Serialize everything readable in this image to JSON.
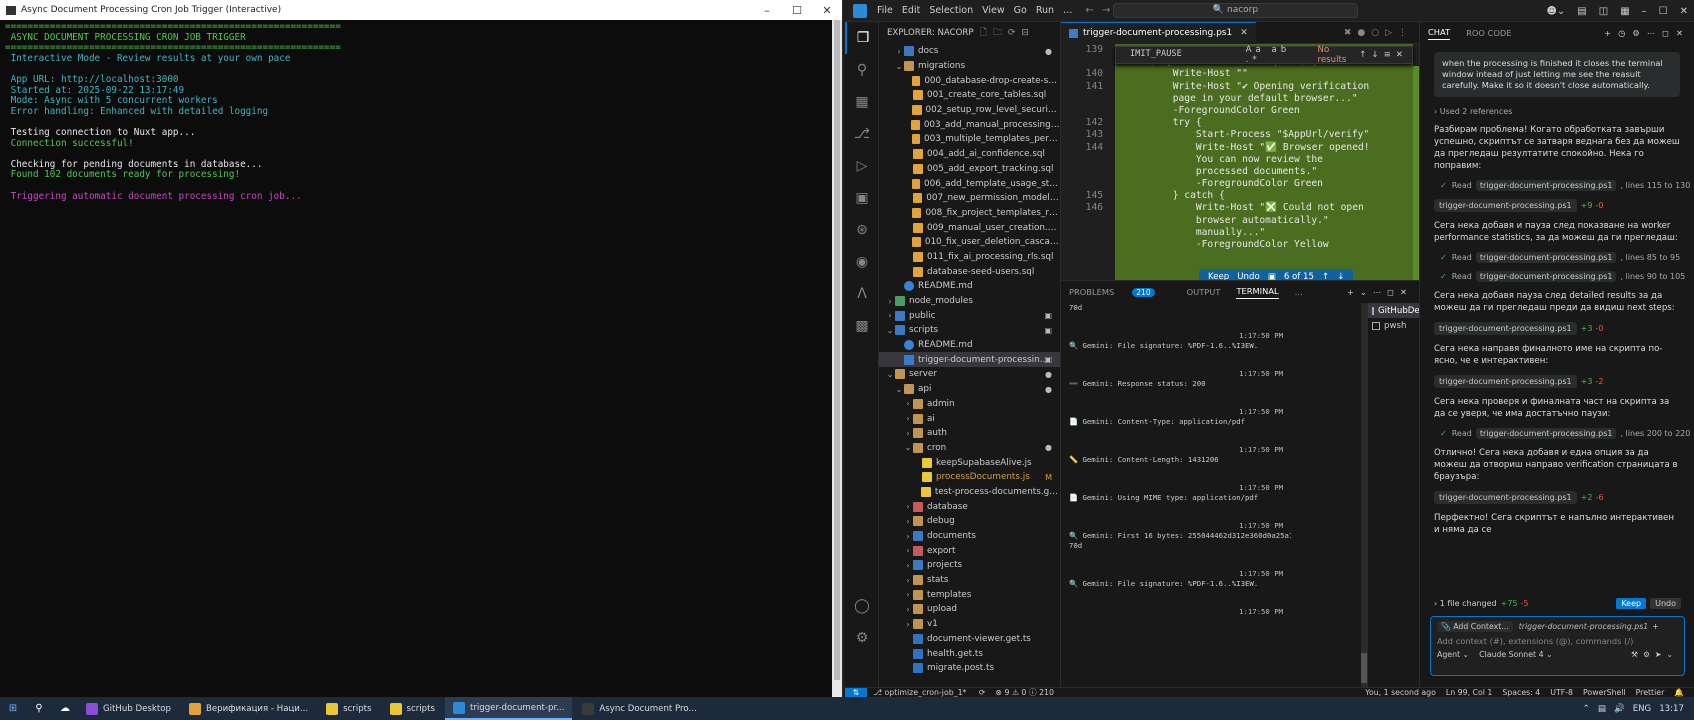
{
  "console": {
    "title": "Async Document Processing Cron Job Trigger (Interactive)",
    "lines": [
      {
        "text": "============================================================",
        "color": "green"
      },
      {
        "text": " ASYNC DOCUMENT PROCESSING CRON JOB TRIGGER",
        "color": "green"
      },
      {
        "text": "============================================================",
        "color": "green"
      },
      {
        "text": " Interactive Mode - Review results at your own pace",
        "color": "cyan"
      },
      {
        "text": "",
        "color": "white"
      },
      {
        "text": " App URL: http://localhost:3000",
        "color": "cyan"
      },
      {
        "text": " Started at: 2025-09-22 13:17:49",
        "color": "cyan"
      },
      {
        "text": " Mode: Async with 5 concurrent workers",
        "color": "cyan"
      },
      {
        "text": " Error handling: Enhanced with detailed logging",
        "color": "cyan"
      },
      {
        "text": "",
        "color": "white"
      },
      {
        "text": " Testing connection to Nuxt app...",
        "color": "white"
      },
      {
        "text": " Connection successful!",
        "color": "green"
      },
      {
        "text": "",
        "color": "white"
      },
      {
        "text": " Checking for pending documents in database...",
        "color": "white"
      },
      {
        "text": " Found 102 documents ready for processing!",
        "color": "green"
      },
      {
        "text": "",
        "color": "white"
      },
      {
        "text": " Triggering automatic document processing cron job...",
        "color": "magenta"
      }
    ]
  },
  "vscode": {
    "menu": [
      "File",
      "Edit",
      "Selection",
      "View",
      "Go",
      "Run",
      "…"
    ],
    "search": "nacorp",
    "explorer_title": "EXPLORER: NACORP",
    "tree": [
      {
        "depth": 1,
        "chev": "›",
        "icon": "folder-b",
        "name": "docs",
        "mark": "●"
      },
      {
        "depth": 1,
        "chev": "⌄",
        "icon": "folder",
        "name": "migrations",
        "mark": ""
      },
      {
        "depth": 2,
        "chev": "",
        "icon": "sql",
        "name": "000_database-drop-create-schem...",
        "mark": ""
      },
      {
        "depth": 2,
        "chev": "",
        "icon": "sql",
        "name": "001_create_core_tables.sql",
        "mark": ""
      },
      {
        "depth": 2,
        "chev": "",
        "icon": "sql",
        "name": "002_setup_row_level_security.sql",
        "mark": ""
      },
      {
        "depth": 2,
        "chev": "",
        "icon": "sql",
        "name": "003_add_manual_processing_statu...",
        "mark": ""
      },
      {
        "depth": 2,
        "chev": "",
        "icon": "sql",
        "name": "003_multiple_templates_per_proje...",
        "mark": ""
      },
      {
        "depth": 2,
        "chev": "",
        "icon": "sql",
        "name": "004_add_ai_confidence.sql",
        "mark": ""
      },
      {
        "depth": 2,
        "chev": "",
        "icon": "sql",
        "name": "005_add_export_tracking.sql",
        "mark": ""
      },
      {
        "depth": 2,
        "chev": "",
        "icon": "sql",
        "name": "006_add_template_usage_stats_fu...",
        "mark": ""
      },
      {
        "depth": 2,
        "chev": "",
        "icon": "sql",
        "name": "007_new_permission_model.sql",
        "mark": ""
      },
      {
        "depth": 2,
        "chev": "",
        "icon": "sql",
        "name": "008_fix_project_templates_rls.sql",
        "mark": ""
      },
      {
        "depth": 2,
        "chev": "",
        "icon": "sql",
        "name": "009_manual_user_creation.sql",
        "mark": ""
      },
      {
        "depth": 2,
        "chev": "",
        "icon": "sql",
        "name": "010_fix_user_deletion_cascade.sql",
        "mark": ""
      },
      {
        "depth": 2,
        "chev": "",
        "icon": "sql",
        "name": "011_fix_ai_processing_rls.sql",
        "mark": ""
      },
      {
        "depth": 2,
        "chev": "",
        "icon": "sql",
        "name": "database-seed-users.sql",
        "mark": ""
      },
      {
        "depth": 1,
        "chev": "",
        "icon": "md",
        "name": "README.md",
        "mark": ""
      },
      {
        "depth": 0,
        "chev": "›",
        "icon": "folder-g",
        "name": "node_modules",
        "mark": ""
      },
      {
        "depth": 0,
        "chev": "›",
        "icon": "folder-b",
        "name": "public",
        "mark": "▣"
      },
      {
        "depth": 0,
        "chev": "⌄",
        "icon": "folder-b",
        "name": "scripts",
        "mark": "▣"
      },
      {
        "depth": 1,
        "chev": "",
        "icon": "md",
        "name": "README.md",
        "mark": ""
      },
      {
        "depth": 1,
        "chev": "",
        "icon": "ps",
        "name": "trigger-document-processin...",
        "mark": "▣",
        "selected": true
      },
      {
        "depth": 0,
        "chev": "⌄",
        "icon": "folder",
        "name": "server",
        "mark": "●"
      },
      {
        "depth": 1,
        "chev": "⌄",
        "icon": "folder",
        "name": "api",
        "mark": "●"
      },
      {
        "depth": 2,
        "chev": "›",
        "icon": "folder",
        "name": "admin",
        "mark": ""
      },
      {
        "depth": 2,
        "chev": "›",
        "icon": "folder",
        "name": "ai",
        "mark": ""
      },
      {
        "depth": 2,
        "chev": "›",
        "icon": "folder",
        "name": "auth",
        "mark": ""
      },
      {
        "depth": 2,
        "chev": "⌄",
        "icon": "folder",
        "name": "cron",
        "mark": "●"
      },
      {
        "depth": 3,
        "chev": "",
        "icon": "js",
        "name": "keepSupabaseAlive.js",
        "mark": ""
      },
      {
        "depth": 3,
        "chev": "",
        "icon": "js",
        "name": "processDocuments.js",
        "mark": "M",
        "modified": true
      },
      {
        "depth": 3,
        "chev": "",
        "icon": "js",
        "name": "test-process-documents.get.js",
        "mark": ""
      },
      {
        "depth": 2,
        "chev": "›",
        "icon": "folder-r",
        "name": "database",
        "mark": ""
      },
      {
        "depth": 2,
        "chev": "›",
        "icon": "folder",
        "name": "debug",
        "mark": ""
      },
      {
        "depth": 2,
        "chev": "›",
        "icon": "folder-b",
        "name": "documents",
        "mark": ""
      },
      {
        "depth": 2,
        "chev": "›",
        "icon": "folder-r",
        "name": "export",
        "mark": ""
      },
      {
        "depth": 2,
        "chev": "›",
        "icon": "folder-b",
        "name": "projects",
        "mark": ""
      },
      {
        "depth": 2,
        "chev": "›",
        "icon": "folder",
        "name": "stats",
        "mark": ""
      },
      {
        "depth": 2,
        "chev": "›",
        "icon": "folder",
        "name": "templates",
        "mark": ""
      },
      {
        "depth": 2,
        "chev": "›",
        "icon": "folder",
        "name": "upload",
        "mark": ""
      },
      {
        "depth": 2,
        "chev": "›",
        "icon": "folder",
        "name": "v1",
        "mark": ""
      },
      {
        "depth": 2,
        "chev": "",
        "icon": "ts",
        "name": "document-viewer.get.ts",
        "mark": ""
      },
      {
        "depth": 2,
        "chev": "",
        "icon": "ts",
        "name": "health.get.ts",
        "mark": ""
      },
      {
        "depth": 2,
        "chev": "",
        "icon": "ts",
        "name": "migrate.post.ts",
        "mark": ""
      }
    ],
    "editor": {
      "tab": "trigger-document-processing.ps1",
      "find_text": "IMIT_PAUSE",
      "find_opts": "Aa ab .*",
      "find_result": "No results",
      "gutter": [
        "139",
        "",
        "140",
        "141",
        "",
        "",
        "142",
        "143",
        "144",
        "",
        "",
        "",
        "145",
        "146",
        "",
        "",
        ""
      ],
      "code": [
        "                                        ",
        "      $keyInfo.Character -eq 'Y') {",
        "          Write-Host \"\"",
        "          Write-Host \"✔ Opening verification",
        "          page in your default browser...\"",
        "          -ForegroundColor Green",
        "          try {",
        "              Start-Process \"$AppUrl/verify\"",
        "              Write-Host \"✅ Browser opened!",
        "              You can now review the",
        "              processed documents.\"",
        "              -ForegroundColor Green",
        "          } catch {",
        "              Write-Host \"❎ Could not open",
        "              browser automatically.\"",
        "              manually...\"",
        "              -ForegroundColor Yellow"
      ],
      "keep_bar": {
        "keep": "Keep",
        "undo": "Undo",
        "count": "6 of 15"
      }
    },
    "panel": {
      "tabs": [
        "PROBLEMS",
        "OUTPUT",
        "TERMINAL",
        "…"
      ],
      "problems_count": "210",
      "terminal_lines": [
        {
          "ts": "",
          "text": "70d"
        },
        {
          "ts": "1:17:50 PM",
          "text": "🔍 Gemini: File signature: %PDF-1.6..%I3EW."
        },
        {
          "ts": "1:17:50 PM",
          "text": "➖ Gemini: Response status: 200"
        },
        {
          "ts": "1:17:50 PM",
          "text": "📄 Gemini: Content-Type: application/pdf"
        },
        {
          "ts": "1:17:50 PM",
          "text": "📏 Gemini: Content-Length: 1431206"
        },
        {
          "ts": "1:17:50 PM",
          "text": "📄 Gemini: Using MIME type: application/pdf"
        },
        {
          "ts": "1:17:50 PM",
          "text": "🔍 Gemini: First 16 bytes: 255044462d312e360d0a25a1b3c5d\n70d"
        },
        {
          "ts": "1:17:50 PM",
          "text": "🔍 Gemini: File signature: %PDF-1.6..%I3EW."
        },
        {
          "ts": "1:17:50 PM",
          "text": ""
        }
      ],
      "terminals": [
        "GitHubDesktop",
        "pwsh"
      ]
    },
    "chat": {
      "tabs": [
        "CHAT",
        "ROO CODE"
      ],
      "user_message": "when the processing is finished it closes the terminal window intead of just letting me see the reasult carefully. Make it so it doesn't close automatically.",
      "refs": "›  Used 2 references",
      "p1": "Разбирам проблема! Когато обработката завърши успешно, скриптът се затваря веднага без да можеш да прегледаш резултатите спокойно. Нека го поправим:",
      "read1": {
        "file": "trigger-document-processing.ps1",
        "range": ", lines 115 to 130"
      },
      "file1": {
        "name": "trigger-document-processing.ps1",
        "add": "+9",
        "del": "-0"
      },
      "p2": "Сега нека добавя и пауза след показване на worker performance statistics, за да можеш да ги прегледаш:",
      "read2": {
        "file": "trigger-document-processing.ps1",
        "range": ", lines 85 to 95"
      },
      "read3": {
        "file": "trigger-document-processing.ps1",
        "range": ", lines 90 to 105"
      },
      "p3": "Сега нека добавя пауза след detailed results за да можеш да ги прегледаш преди да видиш next steps:",
      "file2": {
        "name": "trigger-document-processing.ps1",
        "add": "+3",
        "del": "-0"
      },
      "p4": "Сега нека направя финалното име на скрипта по-ясно, че е интерактивен:",
      "file3": {
        "name": "trigger-document-processing.ps1",
        "add": "+3",
        "del": "-2"
      },
      "p5": "Сега нека проверя и финалната част на скрипта за да се уверя, че има достатъчно паузи:",
      "read4": {
        "file": "trigger-document-processing.ps1",
        "range": ", lines 200 to 220"
      },
      "p6": "Отлично! Сега нека добавя и една опция за да можеш да отвориш направо verification страницата в браузъра:",
      "file4": {
        "name": "trigger-document-processing.ps1",
        "add": "+2",
        "del": "-6"
      },
      "p7": "Перфектно! Сега скриптът е напълно интерактивен и няма да се",
      "changed": {
        "label": "›  1 file changed",
        "add": "+75",
        "del": "-5",
        "keep": "Keep",
        "undo": "Undo"
      },
      "input": {
        "add_context": "Add Context...",
        "file": "trigger-document-processing.ps1",
        "placeholder": "Add context (#), extensions (@), commands (/)",
        "mode": "Agent ⌄",
        "model": "Claude Sonnet 4 ⌄"
      }
    },
    "status": {
      "branch": "optimize_cron-job_1*",
      "problems": "⊗ 9 ⚠ 0 ⓘ 210",
      "blame": "You, 1 second ago",
      "pos": "Ln 99, Col 1",
      "spaces": "Spaces: 4",
      "enc": "UTF-8",
      "lang": "PowerShell",
      "prettier": "Prettier"
    }
  },
  "taskbar": {
    "apps": [
      {
        "label": "GitHub Desktop",
        "color": "#8a4ed6"
      },
      {
        "label": "Верификация - Наци...",
        "color": "#e0a53a"
      },
      {
        "label": "scripts",
        "color": "#e8c73b"
      },
      {
        "label": "scripts",
        "color": "#e8c73b"
      },
      {
        "label": "trigger-document-pr...",
        "color": "#2b8bd6",
        "active": true
      },
      {
        "label": "Async Document Pro...",
        "color": "#3a3a3a"
      }
    ],
    "lang": "ENG",
    "time": "13:17"
  }
}
